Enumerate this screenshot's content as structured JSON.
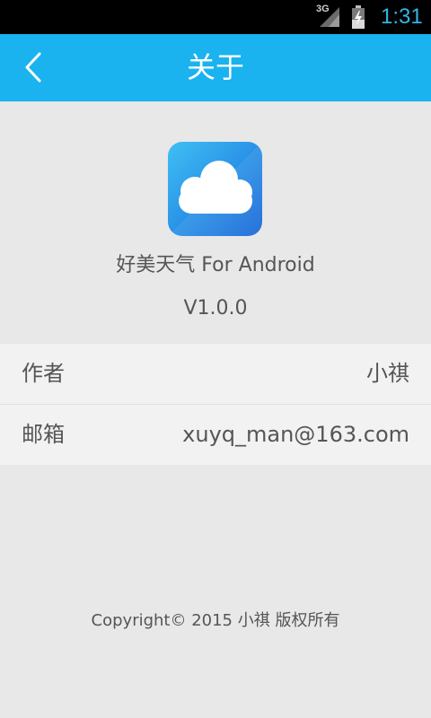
{
  "status_bar": {
    "network": "3G",
    "time": "1:31"
  },
  "header": {
    "title": "关于",
    "back_icon": "chevron-left-icon",
    "color": "#1ab3ef"
  },
  "app": {
    "icon": "cloud-icon",
    "name": "好美天气 For Android",
    "version": "V1.0.0"
  },
  "info": [
    {
      "label": "作者",
      "value": "小祺"
    },
    {
      "label": "邮箱",
      "value": "xuyq_man@163.com"
    }
  ],
  "footer": {
    "copyright": "Copyright© 2015 小祺 版权所有"
  }
}
